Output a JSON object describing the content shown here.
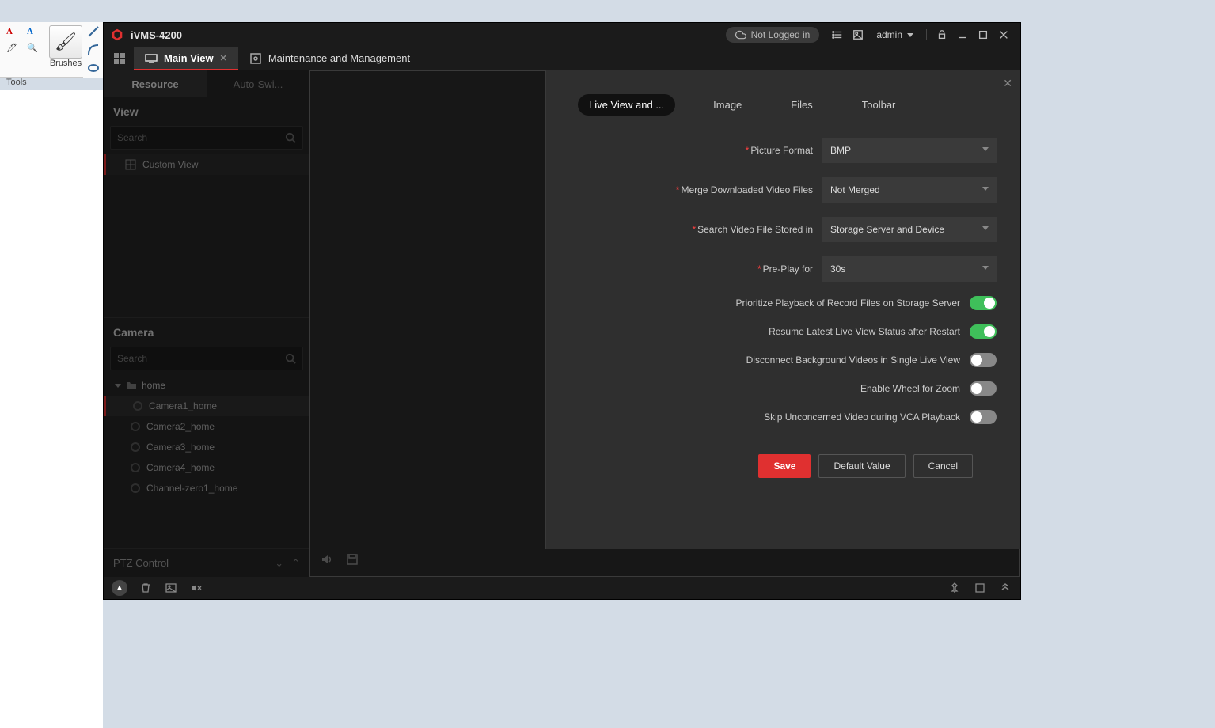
{
  "paint": {
    "brushes": "Brushes",
    "tools": "Tools"
  },
  "app": {
    "title": "iVMS-4200",
    "not_logged": "Not Logged in",
    "admin": "admin"
  },
  "tabs": {
    "main_view": "Main View",
    "maint": "Maintenance and Management"
  },
  "side": {
    "resource": "Resource",
    "auto": "Auto-Swi...",
    "view": "View",
    "camera": "Camera",
    "search": "Search",
    "custom_view": "Custom View",
    "home": "home",
    "ptz": "PTZ Control",
    "cams": [
      "Camera1_home",
      "Camera2_home",
      "Camera3_home",
      "Camera4_home",
      "Channel-zero1_home"
    ]
  },
  "settings": {
    "tabs": {
      "live": "Live View and ...",
      "image": "Image",
      "files": "Files",
      "toolbar": "Toolbar"
    },
    "fields": {
      "picture_format": {
        "label": "Picture Format",
        "value": "BMP"
      },
      "merge": {
        "label": "Merge Downloaded Video Files",
        "value": "Not Merged"
      },
      "search_stored": {
        "label": "Search Video File Stored in",
        "value": "Storage Server and Device"
      },
      "preplay": {
        "label": "Pre-Play for",
        "value": "30s"
      },
      "prioritize": {
        "label": "Prioritize Playback of Record Files on Storage Server"
      },
      "resume": {
        "label": "Resume Latest Live View Status after Restart"
      },
      "disconnect": {
        "label": "Disconnect Background Videos in Single Live View"
      },
      "wheel": {
        "label": "Enable Wheel for Zoom"
      },
      "skip": {
        "label": "Skip Unconcerned Video during VCA Playback"
      }
    },
    "buttons": {
      "save": "Save",
      "default": "Default Value",
      "cancel": "Cancel"
    }
  }
}
